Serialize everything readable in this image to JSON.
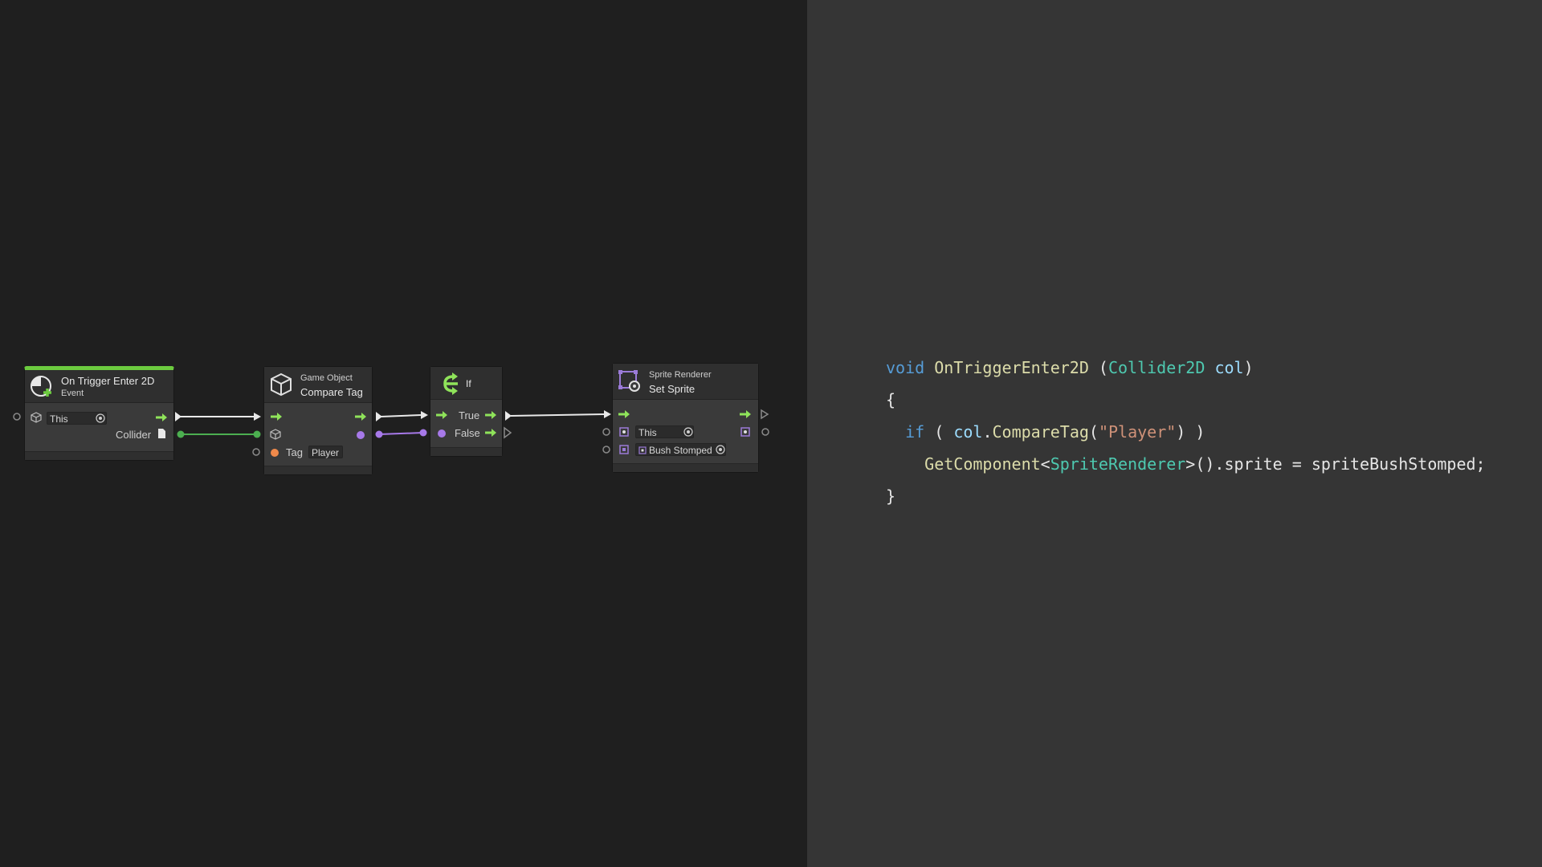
{
  "nodes": {
    "trigger": {
      "title": "On Trigger Enter 2D",
      "subtitle": "Event",
      "this_label": "This",
      "collider_label": "Collider"
    },
    "compare_tag": {
      "category": "Game Object",
      "title": "Compare Tag",
      "tag_label": "Tag",
      "tag_value": "Player"
    },
    "if_node": {
      "title": "If",
      "true_label": "True",
      "false_label": "False"
    },
    "set_sprite": {
      "category": "Sprite Renderer",
      "title": "Set Sprite",
      "this_label": "This",
      "sprite_value": "Bush Stomped"
    }
  },
  "code": {
    "line1": {
      "kw": "void",
      "fn": "OnTriggerEnter2D",
      "open": " (",
      "type": "Collider2D",
      "param": "col",
      "close": ")"
    },
    "line2": "{",
    "line3": {
      "kw": "if",
      "open": " ( ",
      "obj": "col",
      "dot": ".",
      "method": "CompareTag",
      "paren": "(",
      "str": "\"Player\"",
      "close": ") )"
    },
    "line4": {
      "method": "GetComponent",
      "lt": "<",
      "type": "SpriteRenderer",
      "rest": ">().sprite = spriteBushStomped;"
    },
    "line5": "}"
  },
  "colors": {
    "graph_bg": "#1f1f1f",
    "code_bg": "#353535",
    "flow": "#8fe35a",
    "object_port": "#4caf50",
    "bool_port": "#a779e9",
    "string_port": "#f08a4b",
    "event_bar": "#6ccb3f",
    "sprite_icon": "#9b7bd8"
  },
  "icons": [
    "event-icon",
    "cube-icon",
    "branch-icon",
    "sprite-renderer-icon",
    "file-icon",
    "target-icon",
    "flow-arrow-icon"
  ]
}
